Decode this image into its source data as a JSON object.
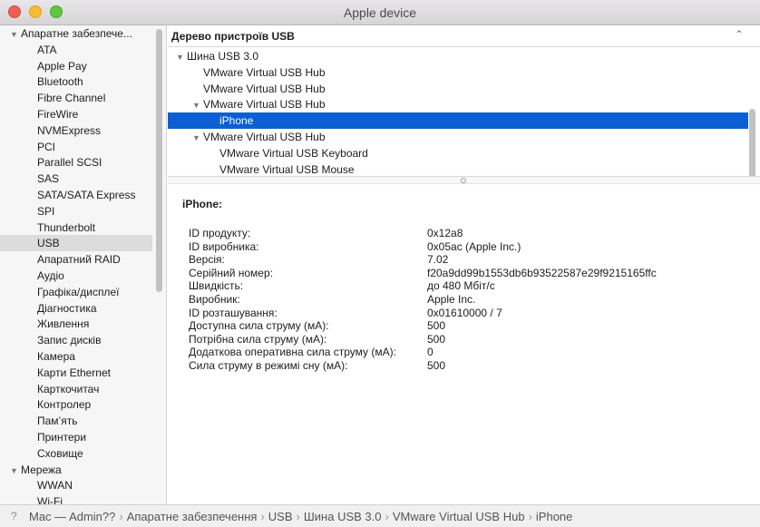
{
  "window": {
    "title": "Apple device"
  },
  "sidebar": {
    "items": [
      {
        "label": "Апаратне забезпече...",
        "type": "group",
        "expanded": true
      },
      {
        "label": "ATA",
        "type": "child"
      },
      {
        "label": "Apple Pay",
        "type": "child"
      },
      {
        "label": "Bluetooth",
        "type": "child"
      },
      {
        "label": "Fibre Channel",
        "type": "child"
      },
      {
        "label": "FireWire",
        "type": "child"
      },
      {
        "label": "NVMExpress",
        "type": "child"
      },
      {
        "label": "PCI",
        "type": "child"
      },
      {
        "label": "Parallel SCSI",
        "type": "child"
      },
      {
        "label": "SAS",
        "type": "child"
      },
      {
        "label": "SATA/SATA Express",
        "type": "child"
      },
      {
        "label": "SPI",
        "type": "child"
      },
      {
        "label": "Thunderbolt",
        "type": "child"
      },
      {
        "label": "USB",
        "type": "child",
        "selected": true
      },
      {
        "label": "Апаратний RAID",
        "type": "child"
      },
      {
        "label": "Аудіо",
        "type": "child"
      },
      {
        "label": "Графіка/дисплеї",
        "type": "child"
      },
      {
        "label": "Діагностика",
        "type": "child"
      },
      {
        "label": "Живлення",
        "type": "child"
      },
      {
        "label": "Запис дисків",
        "type": "child"
      },
      {
        "label": "Камера",
        "type": "child"
      },
      {
        "label": "Карти Ethernet",
        "type": "child"
      },
      {
        "label": "Карткочитач",
        "type": "child"
      },
      {
        "label": "Контролер",
        "type": "child"
      },
      {
        "label": "Пам’ять",
        "type": "child"
      },
      {
        "label": "Принтери",
        "type": "child"
      },
      {
        "label": "Сховище",
        "type": "child"
      },
      {
        "label": "Мережа",
        "type": "group",
        "expanded": true
      },
      {
        "label": "WWAN",
        "type": "child"
      },
      {
        "label": "Wi-Fi",
        "type": "child"
      }
    ]
  },
  "tree": {
    "header": "Дерево пристроїв USB",
    "rows": [
      {
        "label": "Шина USB 3.0",
        "level": 0,
        "expandable": true
      },
      {
        "label": "VMware Virtual USB Hub",
        "level": 1,
        "expandable": false
      },
      {
        "label": "VMware Virtual USB Hub",
        "level": 1,
        "expandable": false
      },
      {
        "label": "VMware Virtual USB Hub",
        "level": 1,
        "expandable": true
      },
      {
        "label": "iPhone",
        "level": 2,
        "expandable": false,
        "selected": true
      },
      {
        "label": "VMware Virtual USB Hub",
        "level": 1,
        "expandable": true
      },
      {
        "label": "VMware Virtual USB Keyboard",
        "level": 2,
        "expandable": false
      },
      {
        "label": "VMware Virtual USB Mouse",
        "level": 2,
        "expandable": false
      }
    ]
  },
  "detail": {
    "title": "iPhone:",
    "properties": [
      {
        "label": "ID продукту:",
        "value": "0x12a8"
      },
      {
        "label": "ID виробника:",
        "value": "0x05ac (Apple Inc.)"
      },
      {
        "label": "Версія:",
        "value": "7.02"
      },
      {
        "label": "Серійний номер:",
        "value": "f20a9dd99b1553db6b93522587e29f9215165ffc"
      },
      {
        "label": "Швидкість:",
        "value": "до 480 Мбіт/с"
      },
      {
        "label": "Виробник:",
        "value": "Apple Inc."
      },
      {
        "label": "ID розташування:",
        "value": "0x01610000 / 7"
      },
      {
        "label": "Доступна сила струму (мА):",
        "value": "500"
      },
      {
        "label": "Потрібна сила струму (мА):",
        "value": "500"
      },
      {
        "label": "Додаткова оперативна сила струму (мА):",
        "value": "0"
      },
      {
        "label": "Сила струму в режимі сну (мА):",
        "value": "500"
      }
    ]
  },
  "pathbar": {
    "help": "?",
    "segments": [
      "Mac — Admin??",
      "Апаратне забезпечення",
      "USB",
      "Шина USB 3.0",
      "VMware Virtual USB Hub",
      "iPhone"
    ],
    "separator": "›"
  },
  "colors": {
    "selection": "#0b5fd3",
    "sidebar_selection": "#dcdcdc"
  }
}
